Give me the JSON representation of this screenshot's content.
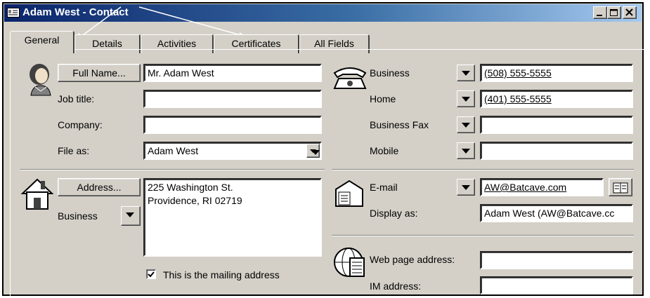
{
  "window": {
    "title": "Adam West - Contact",
    "controls": [
      "minimize",
      "maximize",
      "close"
    ]
  },
  "tabs": [
    {
      "label": "General",
      "active": true
    },
    {
      "label": "Details",
      "active": false
    },
    {
      "label": "Activities",
      "active": false
    },
    {
      "label": "Certificates",
      "active": false
    },
    {
      "label": "All Fields",
      "active": false
    }
  ],
  "name_section": {
    "full_name_button": "Full Name...",
    "full_name_value": "Mr. Adam West",
    "job_title_label": "Job title:",
    "job_title_value": "",
    "company_label": "Company:",
    "company_value": "",
    "file_as_label": "File as:",
    "file_as_value": "Adam West"
  },
  "address_section": {
    "address_button": "Address...",
    "address_type": "Business",
    "address_line1": "225 Washington St.",
    "address_line2": "Providence, RI  02719",
    "mailing_checkbox_label": "This is the mailing address",
    "mailing_checked": true
  },
  "phone_section": {
    "phones": [
      {
        "label": "Business",
        "value": "(508) 555-5555"
      },
      {
        "label": "Home",
        "value": "(401) 555-5555"
      },
      {
        "label": "Business Fax",
        "value": ""
      },
      {
        "label": "Mobile",
        "value": ""
      }
    ]
  },
  "email_section": {
    "email_label": "E-mail",
    "email_value": "AW@Batcave.com",
    "display_as_label": "Display as:",
    "display_as_value": "Adam West (AW@Batcave.cc"
  },
  "web_section": {
    "web_label": "Web page address:",
    "web_value": "",
    "im_label": "IM address:",
    "im_value": ""
  },
  "colors": {
    "title_gradient_start": "#0a246a",
    "title_gradient_end": "#a6caf0",
    "face": "#d4d0c8"
  }
}
